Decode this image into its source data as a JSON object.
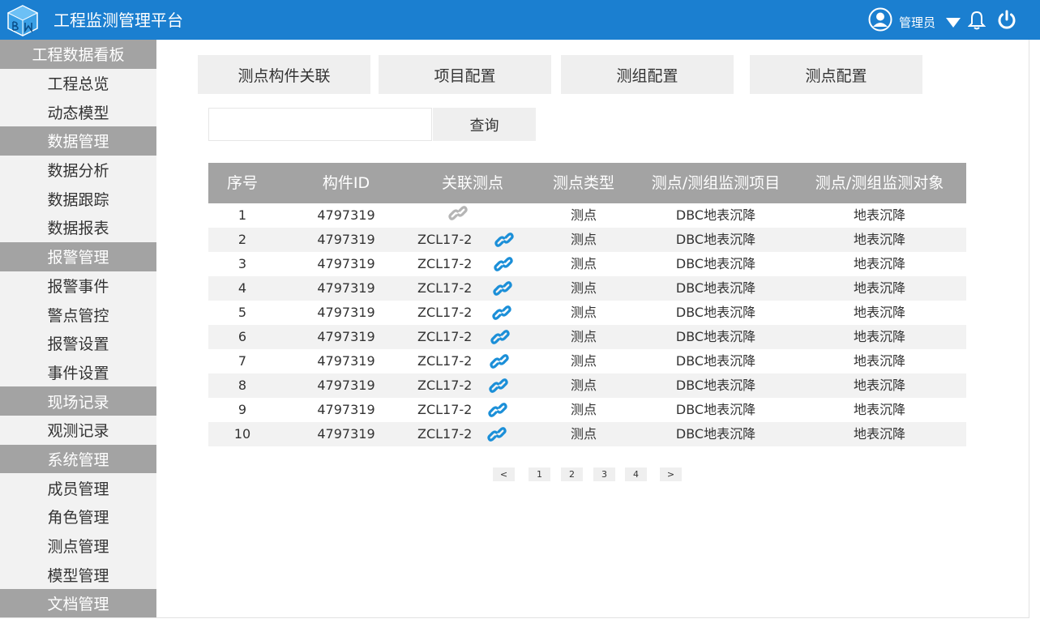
{
  "app": {
    "title": "工程监测管理平台"
  },
  "header": {
    "user": "管理员"
  },
  "sidebar": [
    {
      "type": "group",
      "label": "工程数据看板"
    },
    {
      "type": "item",
      "label": "工程总览"
    },
    {
      "type": "item",
      "label": "动态模型"
    },
    {
      "type": "group",
      "label": "数据管理"
    },
    {
      "type": "item",
      "label": "数据分析"
    },
    {
      "type": "item",
      "label": "数据跟踪"
    },
    {
      "type": "item",
      "label": "数据报表"
    },
    {
      "type": "group",
      "label": "报警管理"
    },
    {
      "type": "item",
      "label": "报警事件"
    },
    {
      "type": "item",
      "label": "警点管控"
    },
    {
      "type": "item",
      "label": "报警设置"
    },
    {
      "type": "item",
      "label": "事件设置"
    },
    {
      "type": "group",
      "label": "现场记录"
    },
    {
      "type": "item",
      "label": "观测记录"
    },
    {
      "type": "group",
      "label": "系统管理"
    },
    {
      "type": "item",
      "label": "成员管理"
    },
    {
      "type": "item",
      "label": "角色管理"
    },
    {
      "type": "item",
      "label": "测点管理"
    },
    {
      "type": "item",
      "label": "模型管理"
    },
    {
      "type": "group",
      "label": "文档管理"
    }
  ],
  "tabs": [
    "测点构件关联",
    "项目配置",
    "测组配置",
    "测点配置"
  ],
  "search": {
    "value": "",
    "button": "查询"
  },
  "table": {
    "columns": [
      "序号",
      "构件ID",
      "关联测点",
      "测点类型",
      "测点/测组监测项目",
      "测点/测组监测对象"
    ],
    "rows": [
      {
        "no": "1",
        "id": "4797319",
        "point": "",
        "type": "测点",
        "item": "DBC地表沉降",
        "object": "地表沉降",
        "linked": false
      },
      {
        "no": "2",
        "id": "4797319",
        "point": "ZCL17-2",
        "type": "测点",
        "item": "DBC地表沉降",
        "object": "地表沉降",
        "linked": true
      },
      {
        "no": "3",
        "id": "4797319",
        "point": "ZCL17-2",
        "type": "测点",
        "item": "DBC地表沉降",
        "object": "地表沉降",
        "linked": true
      },
      {
        "no": "4",
        "id": "4797319",
        "point": "ZCL17-2",
        "type": "测点",
        "item": "DBC地表沉降",
        "object": "地表沉降",
        "linked": true
      },
      {
        "no": "5",
        "id": "4797319",
        "point": "ZCL17-2",
        "type": "测点",
        "item": "DBC地表沉降",
        "object": "地表沉降",
        "linked": true
      },
      {
        "no": "6",
        "id": "4797319",
        "point": "ZCL17-2",
        "type": "测点",
        "item": "DBC地表沉降",
        "object": "地表沉降",
        "linked": true
      },
      {
        "no": "7",
        "id": "4797319",
        "point": "ZCL17-2",
        "type": "测点",
        "item": "DBC地表沉降",
        "object": "地表沉降",
        "linked": true
      },
      {
        "no": "8",
        "id": "4797319",
        "point": "ZCL17-2",
        "type": "测点",
        "item": "DBC地表沉降",
        "object": "地表沉降",
        "linked": true
      },
      {
        "no": "9",
        "id": "4797319",
        "point": "ZCL17-2",
        "type": "测点",
        "item": "DBC地表沉降",
        "object": "地表沉降",
        "linked": true
      },
      {
        "no": "10",
        "id": "4797319",
        "point": "ZCL17-2",
        "type": "测点",
        "item": "DBC地表沉降",
        "object": "地表沉降",
        "linked": true
      }
    ]
  },
  "pagination": {
    "prev": "<",
    "pages": [
      "1",
      "2",
      "3",
      "4"
    ],
    "next": ">"
  },
  "colors": {
    "header": "#1b7fd0",
    "link_active": "#1b8fd8",
    "link_inactive": "#b5b5b5",
    "sidebar_group": "#a3a3a3"
  }
}
